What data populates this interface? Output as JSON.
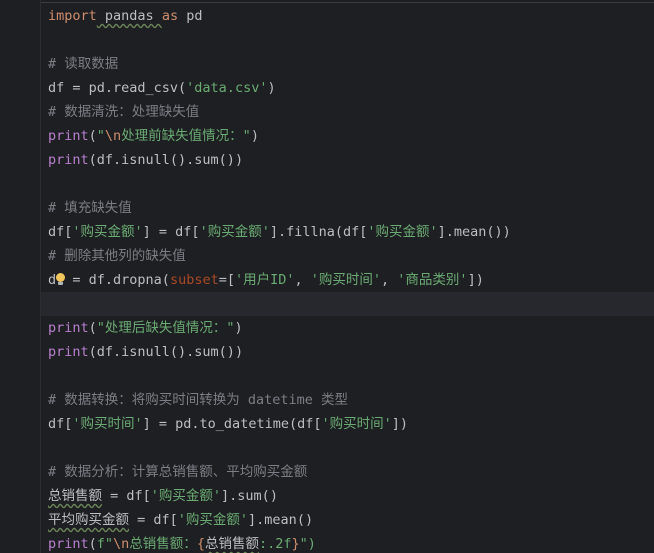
{
  "code": {
    "l1_kw_import": "import",
    "l1_mod": " pandas ",
    "l1_kw_as": "as",
    "l1_alias": " pd",
    "l3_comment": "# 读取数据",
    "l4_a": "df = pd.read_csv(",
    "l4_str": "'data.csv'",
    "l4_b": ")",
    "l5_comment": "# 数据清洗：处理缺失值",
    "l6_fn": "print",
    "l6_a": "(",
    "l6_q1": "\"",
    "l6_esc": "\\n",
    "l6_str": "处理前缺失值情况：\"",
    "l6_b": ")",
    "l7_fn": "print",
    "l7_rest": "(df.isnull().sum())",
    "l9_comment": "# 填充缺失值",
    "l10_a": "df[",
    "l10_s1": "'购买金额'",
    "l10_b": "] = df[",
    "l10_s2": "'购买金额'",
    "l10_c": "].fillna(df[",
    "l10_s3": "'购买金额'",
    "l10_d": "].mean())",
    "l11_comment": "# 删除其他列的缺失值",
    "l12_a": "df",
    "l12_b": " = df.dropna(",
    "l12_param": "subset",
    "l12_c": "=[",
    "l12_s1": "'用户ID'",
    "l12_d": ", ",
    "l12_s2": "'购买时间'",
    "l12_e": ", ",
    "l12_s3": "'商品类别'",
    "l12_f": "])",
    "l14_fn": "print",
    "l14_a": "(",
    "l14_str": "\"处理后缺失值情况：\"",
    "l14_b": ")",
    "l15_fn": "print",
    "l15_rest": "(df.isnull().sum())",
    "l17_comment": "# 数据转换：将购买时间转换为 datetime 类型",
    "l18_a": "df[",
    "l18_s1": "'购买时间'",
    "l18_b": "] = pd.to_datetime(df[",
    "l18_s2": "'购买时间'",
    "l18_c": "])",
    "l20_comment": "# 数据分析：计算总销售额、平均购买金额",
    "l21_var": "总销售额",
    "l21_a": " = df[",
    "l21_s1": "'购买金额'",
    "l21_b": "].sum()",
    "l22_var": "平均购买金额",
    "l22_a": " = df[",
    "l22_s1": "'购买金额'",
    "l22_b": "].mean()",
    "l23_fn": "print",
    "l23_a": "(",
    "l23_f": "f\"",
    "l23_esc": "\\n",
    "l23_str": "总销售额：",
    "l23_brace1": "{",
    "l23_expr": "总销售额",
    "l23_fmt": ":.2f",
    "l23_brace2": "}",
    "l23_end": "\")"
  },
  "icons": {
    "bulb": "intention-bulb-icon"
  }
}
